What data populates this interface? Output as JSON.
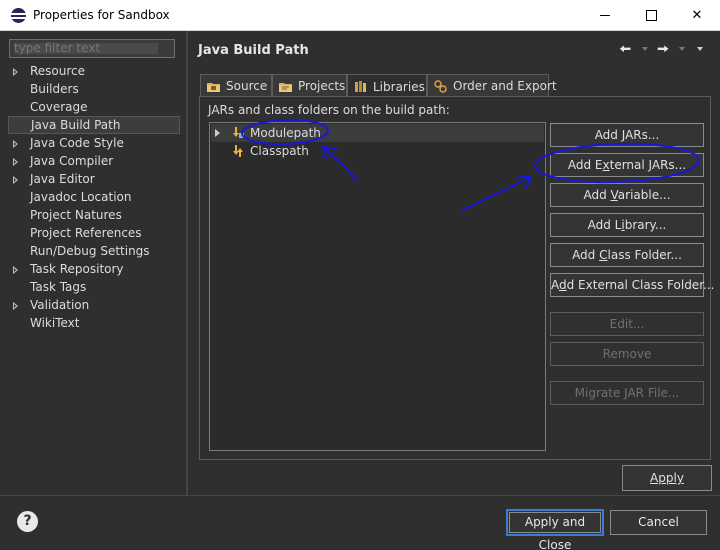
{
  "window": {
    "title": "Properties for Sandbox",
    "icon": "eclipse-icon",
    "controls": {
      "minimize": "minimize-icon",
      "maximize": "maximize-icon",
      "close": "close-icon"
    }
  },
  "sidebar": {
    "filter_placeholder": "type filter text",
    "items": [
      {
        "label": "Resource",
        "expandable": true
      },
      {
        "label": "Builders",
        "expandable": false
      },
      {
        "label": "Coverage",
        "expandable": false
      },
      {
        "label": "Java Build Path",
        "expandable": false,
        "selected": true
      },
      {
        "label": "Java Code Style",
        "expandable": true
      },
      {
        "label": "Java Compiler",
        "expandable": true
      },
      {
        "label": "Java Editor",
        "expandable": true
      },
      {
        "label": "Javadoc Location",
        "expandable": false
      },
      {
        "label": "Project Natures",
        "expandable": false
      },
      {
        "label": "Project References",
        "expandable": false
      },
      {
        "label": "Run/Debug Settings",
        "expandable": false
      },
      {
        "label": "Task Repository",
        "expandable": true
      },
      {
        "label": "Task Tags",
        "expandable": false
      },
      {
        "label": "Validation",
        "expandable": true
      },
      {
        "label": "WikiText",
        "expandable": false
      }
    ]
  },
  "page": {
    "title": "Java Build Path",
    "tabs": [
      {
        "label": "Source",
        "icon": "source-folder-icon"
      },
      {
        "label": "Projects",
        "icon": "projects-folder-icon"
      },
      {
        "label": "Libraries",
        "icon": "libraries-icon",
        "active": true
      },
      {
        "label": "Order and Export",
        "icon": "order-export-icon"
      }
    ],
    "section_label": "JARs and class folders on the build path:",
    "tree": [
      {
        "label": "Modulepath",
        "expandable": true
      },
      {
        "label": "Classpath",
        "expandable": false
      }
    ],
    "buttons": [
      {
        "label": "Add JARs...",
        "mnemonic": "J",
        "enabled": true
      },
      {
        "label": "Add External JARs...",
        "mnemonic": "x",
        "enabled": true
      },
      {
        "label": "Add Variable...",
        "mnemonic": "V",
        "enabled": true
      },
      {
        "label": "Add Library...",
        "mnemonic": "i",
        "enabled": true
      },
      {
        "label": "Add Class Folder...",
        "mnemonic": "C",
        "enabled": true
      },
      {
        "label": "Add External Class Folder...",
        "mnemonic": "d",
        "enabled": true
      },
      {
        "label": "Edit...",
        "mnemonic": "",
        "enabled": false
      },
      {
        "label": "Remove",
        "mnemonic": "",
        "enabled": false
      },
      {
        "label": "Migrate JAR File...",
        "mnemonic": "",
        "enabled": false
      }
    ],
    "apply_label": "Apply"
  },
  "footer": {
    "help_icon": "help-icon",
    "apply_close_label": "Apply and Close",
    "cancel_label": "Cancel"
  },
  "colors": {
    "background": "#2f2f2f",
    "text": "#dcdcdc",
    "default_button_border": "#3d7ad6",
    "annotation": "#1a17d8"
  }
}
